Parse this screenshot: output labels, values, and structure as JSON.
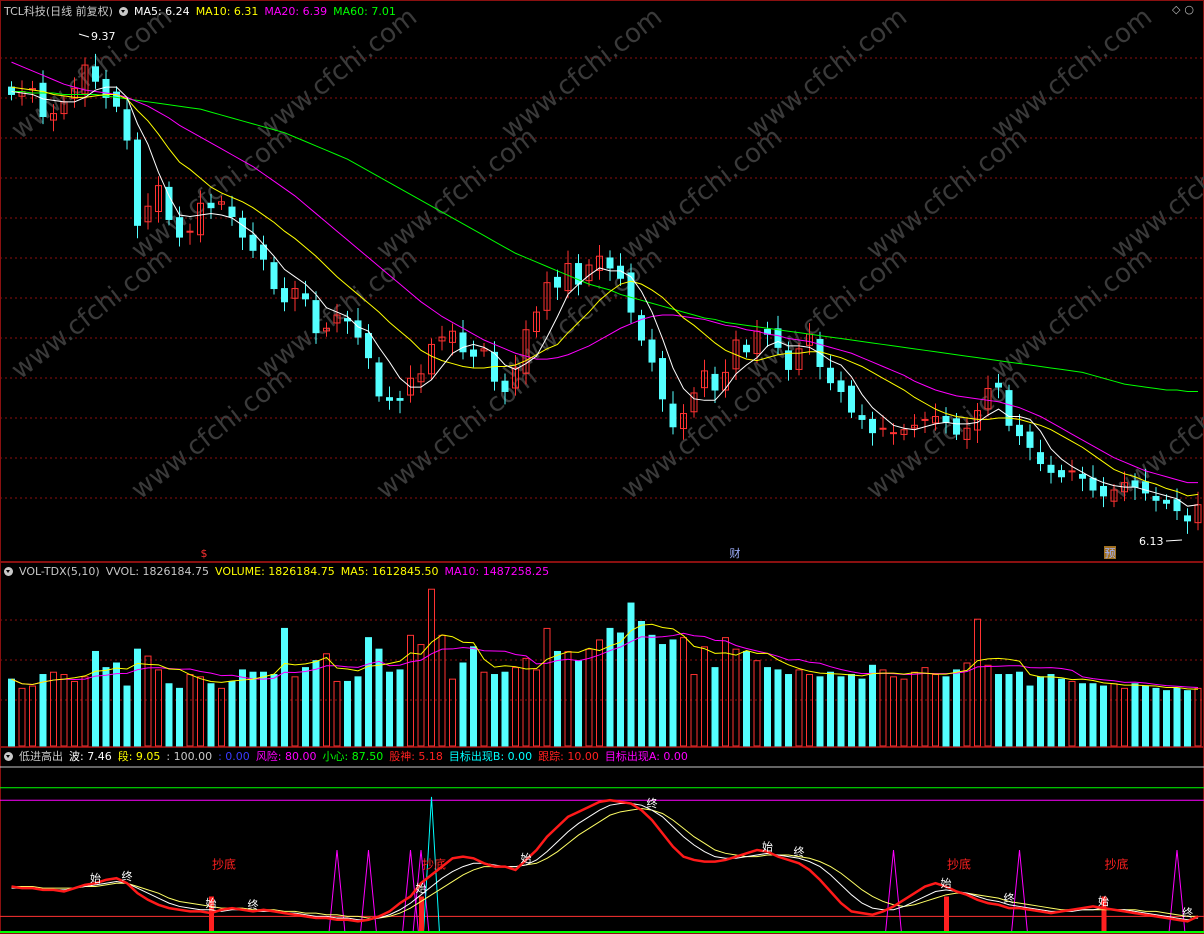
{
  "header_price": {
    "title": "TCL科技(日线 前复权)",
    "items": [
      {
        "label": "MA5: 6.24",
        "color": "#ffffff"
      },
      {
        "label": "MA10: 6.31",
        "color": "#ffff00"
      },
      {
        "label": "MA20: 6.39",
        "color": "#ff00ff"
      },
      {
        "label": "MA60: 7.01",
        "color": "#00ff00"
      }
    ],
    "high_label": "9.37",
    "low_label": "6.13",
    "markers": [
      "$",
      "财",
      "预"
    ]
  },
  "header_volume": {
    "title": "VOL-TDX(5,10)",
    "items": [
      {
        "label": "VVOL: 1826184.75",
        "color": "#c8c8c8"
      },
      {
        "label": "VOLUME: 1826184.75",
        "color": "#ffff00"
      },
      {
        "label": "MA5: 1612845.50",
        "color": "#ffff00"
      },
      {
        "label": "MA10: 1487258.25",
        "color": "#ff00ff"
      }
    ]
  },
  "header_indicator": {
    "title": "低进高出",
    "items": [
      {
        "label": "波: 7.46",
        "color": "#ffffff"
      },
      {
        "label": "段: 9.05",
        "color": "#ffff00"
      },
      {
        "label": ": 100.00",
        "color": "#c8c8c8"
      },
      {
        "label": ": 0.00",
        "color": "#0000ff"
      },
      {
        "label": "风险: 80.00",
        "color": "#ff00ff"
      },
      {
        "label": "小心: 87.50",
        "color": "#00ff00"
      },
      {
        "label": "股神: 5.18",
        "color": "#ff2020"
      },
      {
        "label": "目标出现B: 0.00",
        "color": "#00ffff"
      },
      {
        "label": "跟踪: 10.00",
        "color": "#ff2020"
      },
      {
        "label": "目标出现A: 0.00",
        "color": "#ff00ff"
      }
    ],
    "signal_labels": {
      "start": "始",
      "end": "终",
      "bottom": "抄底"
    }
  },
  "watermark": "www.cfchi.com",
  "colors": {
    "up": "#ff3232",
    "down": "#54ffff",
    "grid": "#8a1010"
  },
  "chart_data": [
    {
      "type": "candlestick",
      "title": "TCL科技(日线 前复权)",
      "y_range": [
        6.0,
        9.55
      ],
      "close": [
        9.03,
        9.05,
        9.07,
        8.88,
        8.9,
        8.98,
        9.07,
        9.23,
        9.12,
        9.01,
        8.95,
        8.72,
        8.14,
        8.27,
        8.41,
        8.18,
        8.06,
        8.1,
        8.29,
        8.26,
        8.3,
        8.2,
        8.06,
        7.97,
        7.91,
        7.71,
        7.62,
        7.71,
        7.64,
        7.41,
        7.44,
        7.53,
        7.49,
        7.38,
        7.24,
        6.98,
        6.95,
        6.95,
        7.1,
        7.13,
        7.33,
        7.38,
        7.42,
        7.28,
        7.25,
        7.3,
        7.08,
        7.01,
        7.17,
        7.43,
        7.55,
        7.75,
        7.72,
        7.88,
        7.74,
        7.87,
        7.93,
        7.85,
        7.78,
        7.55,
        7.36,
        7.21,
        6.96,
        6.77,
        6.86,
        7.0,
        7.15,
        7.02,
        7.14,
        7.36,
        7.28,
        7.42,
        7.4,
        7.31,
        7.16,
        7.3,
        7.4,
        7.18,
        7.07,
        7.01,
        6.87,
        6.82,
        6.73,
        6.76,
        6.73,
        6.75,
        6.78,
        6.82,
        6.84,
        6.8,
        6.72,
        6.76,
        6.88,
        7.03,
        7.04,
        6.78,
        6.71,
        6.63,
        6.52,
        6.46,
        6.43,
        6.47,
        6.42,
        6.34,
        6.3,
        6.34,
        6.39,
        6.36,
        6.32,
        6.27,
        6.25,
        6.2,
        6.13,
        6.24
      ],
      "ma5": [
        9.05,
        9.04,
        9.03,
        9.0,
        8.99,
        8.98,
        8.98,
        9.01,
        9.06,
        9.08,
        9.08,
        9.01,
        8.83,
        8.69,
        8.5,
        8.34,
        8.21,
        8.2,
        8.21,
        8.22,
        8.21,
        8.19,
        8.14,
        8.09,
        8.01,
        7.93,
        7.84,
        7.79,
        7.74,
        7.67,
        7.58,
        7.55,
        7.52,
        7.45,
        7.42,
        7.31,
        7.21,
        7.1,
        7.04,
        7.04,
        7.09,
        7.18,
        7.27,
        7.31,
        7.33,
        7.31,
        7.27,
        7.19,
        7.16,
        7.2,
        7.25,
        7.38,
        7.52,
        7.67,
        7.74,
        7.8,
        7.85,
        7.83,
        7.83,
        7.79,
        7.69,
        7.55,
        7.37,
        7.17,
        7.03,
        6.96,
        6.95,
        6.95,
        7.03,
        7.13,
        7.19,
        7.24,
        7.32,
        7.35,
        7.32,
        7.32,
        7.31,
        7.27,
        7.22,
        7.19,
        7.11,
        6.99,
        6.9,
        6.84,
        6.78,
        6.76,
        6.75,
        6.77,
        6.79,
        6.8,
        6.79,
        6.79,
        6.8,
        6.85,
        6.89,
        6.84,
        6.84,
        6.82,
        6.74,
        6.62,
        6.55,
        6.5,
        6.46,
        6.42,
        6.39,
        6.37,
        6.36,
        6.36,
        6.34,
        6.32,
        6.3,
        6.28,
        6.23,
        6.24
      ],
      "ma10": [
        9.08,
        9.07,
        9.06,
        9.05,
        9.03,
        9.02,
        9.01,
        9.01,
        9.02,
        9.03,
        9.03,
        9.0,
        8.92,
        8.85,
        8.76,
        8.66,
        8.57,
        8.52,
        8.46,
        8.4,
        8.36,
        8.33,
        8.3,
        8.26,
        8.21,
        8.16,
        8.1,
        8.05,
        7.99,
        7.93,
        7.86,
        7.79,
        7.73,
        7.67,
        7.61,
        7.55,
        7.48,
        7.42,
        7.36,
        7.29,
        7.25,
        7.22,
        7.2,
        7.18,
        7.17,
        7.17,
        7.18,
        7.18,
        7.19,
        7.22,
        7.26,
        7.3,
        7.33,
        7.41,
        7.48,
        7.55,
        7.63,
        7.69,
        7.74,
        7.76,
        7.74,
        7.7,
        7.65,
        7.58,
        7.51,
        7.46,
        7.4,
        7.34,
        7.29,
        7.26,
        7.23,
        7.22,
        7.24,
        7.26,
        7.27,
        7.27,
        7.28,
        7.28,
        7.26,
        7.24,
        7.21,
        7.18,
        7.14,
        7.1,
        7.06,
        7.02,
        6.97,
        6.93,
        6.89,
        6.86,
        6.84,
        6.83,
        6.82,
        6.82,
        6.83,
        6.83,
        6.82,
        6.8,
        6.78,
        6.75,
        6.71,
        6.67,
        6.63,
        6.58,
        6.53,
        6.48,
        6.45,
        6.43,
        6.4,
        6.38,
        6.35,
        6.33,
        6.3,
        6.31
      ],
      "ma20": [
        9.25,
        9.22,
        9.19,
        9.16,
        9.13,
        9.1,
        9.08,
        9.06,
        9.05,
        9.04,
        9.03,
        9.01,
        8.98,
        8.95,
        8.91,
        8.87,
        8.82,
        8.78,
        8.74,
        8.7,
        8.66,
        8.62,
        8.58,
        8.54,
        8.49,
        8.44,
        8.39,
        8.34,
        8.28,
        8.22,
        8.16,
        8.1,
        8.04,
        7.98,
        7.92,
        7.86,
        7.8,
        7.74,
        7.68,
        7.62,
        7.57,
        7.52,
        7.48,
        7.44,
        7.4,
        7.36,
        7.33,
        7.3,
        7.27,
        7.25,
        7.23,
        7.23,
        7.24,
        7.26,
        7.29,
        7.32,
        7.36,
        7.4,
        7.44,
        7.47,
        7.5,
        7.52,
        7.53,
        7.53,
        7.52,
        7.51,
        7.5,
        7.48,
        7.46,
        7.45,
        7.43,
        7.42,
        7.4,
        7.39,
        7.37,
        7.36,
        7.35,
        7.33,
        7.31,
        7.29,
        7.27,
        7.24,
        7.21,
        7.18,
        7.15,
        7.12,
        7.08,
        7.05,
        7.02,
        7.0,
        6.98,
        6.97,
        6.96,
        6.95,
        6.94,
        6.92,
        6.9,
        6.87,
        6.84,
        6.8,
        6.76,
        6.72,
        6.68,
        6.64,
        6.6,
        6.56,
        6.53,
        6.5,
        6.47,
        6.45,
        6.43,
        6.41,
        6.39,
        6.39
      ],
      "ma60": [
        9.05,
        9.05,
        9.04,
        9.04,
        9.04,
        9.03,
        9.03,
        9.03,
        9.03,
        9.02,
        9.01,
        9.0,
        8.99,
        8.98,
        8.97,
        8.96,
        8.95,
        8.94,
        8.93,
        8.91,
        8.89,
        8.87,
        8.85,
        8.83,
        8.81,
        8.79,
        8.77,
        8.74,
        8.71,
        8.68,
        8.65,
        8.62,
        8.59,
        8.55,
        8.51,
        8.47,
        8.43,
        8.39,
        8.35,
        8.31,
        8.27,
        8.23,
        8.19,
        8.15,
        8.11,
        8.07,
        8.03,
        7.99,
        7.95,
        7.92,
        7.89,
        7.86,
        7.83,
        7.8,
        7.77,
        7.74,
        7.72,
        7.7,
        7.67,
        7.65,
        7.63,
        7.61,
        7.59,
        7.57,
        7.55,
        7.53,
        7.51,
        7.5,
        7.48,
        7.47,
        7.46,
        7.45,
        7.44,
        7.43,
        7.42,
        7.41,
        7.4,
        7.39,
        7.38,
        7.37,
        7.36,
        7.35,
        7.34,
        7.33,
        7.32,
        7.31,
        7.3,
        7.29,
        7.28,
        7.27,
        7.26,
        7.25,
        7.24,
        7.23,
        7.22,
        7.21,
        7.2,
        7.19,
        7.18,
        7.17,
        7.16,
        7.15,
        7.14,
        7.12,
        7.1,
        7.08,
        7.06,
        7.05,
        7.04,
        7.03,
        7.02,
        7.02,
        7.01,
        7.01
      ]
    },
    {
      "type": "bar",
      "title": "VOL-TDX(5,10)",
      "values": [
        1.45,
        1.25,
        1.3,
        1.55,
        1.6,
        1.55,
        1.4,
        1.5,
        2.05,
        1.7,
        1.8,
        1.3,
        2.1,
        1.95,
        1.65,
        1.35,
        1.25,
        1.55,
        1.5,
        1.35,
        1.25,
        1.4,
        1.65,
        1.6,
        1.6,
        1.55,
        2.55,
        1.5,
        1.7,
        1.85,
        2.0,
        1.4,
        1.4,
        1.5,
        2.35,
        2.1,
        1.6,
        1.65,
        2.4,
        2.2,
        3.4,
        2.4,
        1.45,
        1.8,
        2.15,
        1.6,
        1.55,
        1.6,
        1.7,
        1.9,
        1.65,
        2.55,
        2.05,
        2.05,
        1.85,
        2.1,
        2.3,
        2.55,
        2.45,
        3.1,
        2.7,
        2.4,
        2.2,
        2.3,
        2.35,
        1.55,
        2.15,
        1.7,
        2.35,
        2.1,
        2.05,
        1.85,
        1.7,
        1.65,
        1.55,
        1.65,
        1.55,
        1.5,
        1.6,
        1.5,
        1.55,
        1.45,
        1.75,
        1.65,
        1.5,
        1.45,
        1.6,
        1.7,
        1.55,
        1.5,
        1.65,
        1.8,
        2.75,
        1.75,
        1.55,
        1.55,
        1.6,
        1.3,
        1.5,
        1.55,
        1.45,
        1.4,
        1.35,
        1.35,
        1.3,
        1.35,
        1.25,
        1.35,
        1.3,
        1.25,
        1.2,
        1.25,
        1.2,
        1.25
      ]
    },
    {
      "type": "line",
      "title": "低进高出",
      "y_range": [
        0,
        100
      ],
      "reference_lines": [
        100,
        87.5,
        80,
        10
      ],
      "red_line": [
        28,
        27,
        27,
        26,
        26,
        25,
        27,
        29,
        30,
        32,
        33,
        30,
        24,
        20,
        17,
        15,
        14,
        13,
        13,
        12,
        14,
        15,
        14,
        13,
        14,
        13,
        12,
        11,
        10,
        9,
        9,
        8,
        8,
        7,
        8,
        10,
        13,
        18,
        22,
        30,
        35,
        40,
        45,
        46,
        45,
        42,
        40,
        40,
        38,
        44,
        50,
        58,
        64,
        70,
        73,
        76,
        79,
        80,
        79,
        78,
        74,
        68,
        60,
        52,
        46,
        44,
        43,
        43,
        44,
        46,
        48,
        50,
        49,
        46,
        44,
        42,
        38,
        32,
        25,
        18,
        13,
        12,
        11,
        13,
        16,
        20,
        24,
        28,
        30,
        28,
        25,
        23,
        20,
        18,
        17,
        15,
        15,
        14,
        13,
        12,
        13,
        14,
        15,
        16,
        15,
        14,
        13,
        12,
        11,
        10,
        9,
        8,
        7,
        10
      ],
      "white_line": [
        27,
        27,
        27,
        26,
        26,
        26,
        27,
        28,
        29,
        30,
        31,
        30,
        27,
        24,
        21,
        18,
        16,
        15,
        14,
        14,
        13,
        14,
        14,
        13,
        13,
        13,
        12,
        12,
        11,
        10,
        10,
        9,
        9,
        8,
        8,
        9,
        11,
        14,
        18,
        23,
        28,
        33,
        37,
        40,
        42,
        42,
        41,
        40,
        40,
        41,
        44,
        49,
        55,
        61,
        66,
        70,
        74,
        77,
        78,
        78,
        77,
        74,
        70,
        64,
        58,
        53,
        49,
        46,
        45,
        45,
        46,
        47,
        48,
        47,
        46,
        45,
        43,
        40,
        35,
        29,
        23,
        18,
        15,
        14,
        14,
        16,
        19,
        22,
        25,
        26,
        25,
        24,
        22,
        20,
        19,
        17,
        16,
        15,
        14,
        13,
        13,
        13,
        14,
        14,
        15,
        14,
        14,
        13,
        12,
        11,
        10,
        9,
        8,
        9
      ],
      "yellow_line": [
        28,
        28,
        28,
        27,
        27,
        27,
        27,
        28,
        28,
        29,
        30,
        30,
        28,
        26,
        24,
        21,
        19,
        18,
        17,
        16,
        15,
        15,
        15,
        14,
        14,
        14,
        13,
        13,
        12,
        12,
        11,
        11,
        10,
        10,
        9,
        9,
        10,
        12,
        15,
        19,
        23,
        27,
        31,
        35,
        38,
        40,
        40,
        40,
        40,
        41,
        42,
        45,
        49,
        54,
        59,
        63,
        67,
        71,
        73,
        74,
        75,
        74,
        72,
        68,
        63,
        58,
        54,
        50,
        48,
        47,
        46,
        46,
        47,
        47,
        47,
        46,
        45,
        43,
        40,
        36,
        31,
        26,
        22,
        19,
        17,
        16,
        17,
        19,
        21,
        23,
        24,
        24,
        23,
        22,
        21,
        19,
        18,
        17,
        16,
        15,
        14,
        14,
        14,
        14,
        14,
        14,
        14,
        14,
        13,
        13,
        12,
        11,
        10,
        10
      ],
      "signals": [
        {
          "index": 8,
          "label": "始"
        },
        {
          "index": 11,
          "label": "终"
        },
        {
          "index": 19,
          "label": "始"
        },
        {
          "index": 23,
          "label": "终"
        },
        {
          "index": 39,
          "label": "始"
        },
        {
          "index": 49,
          "label": "始"
        },
        {
          "index": 61,
          "label": "终"
        },
        {
          "index": 72,
          "label": "始"
        },
        {
          "index": 75,
          "label": "终"
        },
        {
          "index": 89,
          "label": "始"
        },
        {
          "index": 95,
          "label": "终"
        },
        {
          "index": 104,
          "label": "始"
        },
        {
          "index": 112,
          "label": "终"
        }
      ],
      "bottom_signals": [
        19,
        39,
        89,
        104
      ],
      "spikes": [
        31,
        34,
        38,
        39,
        84,
        96,
        111
      ],
      "cyan_spike": 40
    }
  ]
}
